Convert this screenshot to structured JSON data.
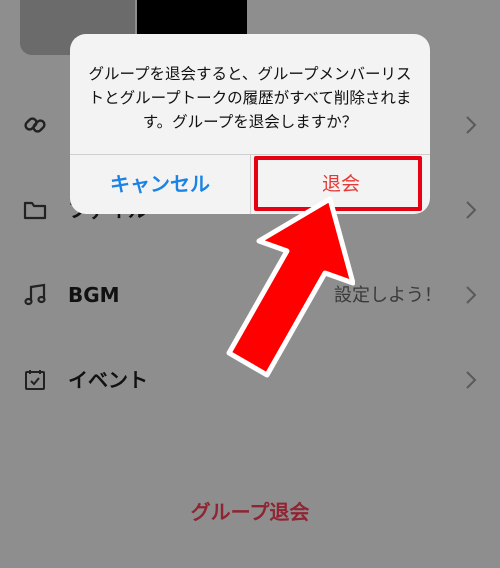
{
  "menu": {
    "items": [
      {
        "label": "",
        "icon": "link-icon"
      },
      {
        "label": "ファイル",
        "icon": "folder-icon"
      },
      {
        "label": "BGM",
        "icon": "music-note-icon",
        "value": "設定しよう！"
      },
      {
        "label": "イベント",
        "icon": "calendar-check-icon"
      }
    ]
  },
  "leave_group_label": "グループ退会",
  "dialog": {
    "message": "グループを退会すると、グループメンバーリストとグループトークの履歴がすべて削除されます。グループを退会しますか？",
    "cancel_label": "キャンセル",
    "confirm_label": "退会"
  },
  "colors": {
    "overlay": "#8e8e8e",
    "cancel": "#1a84e6",
    "confirm": "#e53935",
    "annotation_red": "#e60012",
    "leave_link": "#8f2433"
  }
}
